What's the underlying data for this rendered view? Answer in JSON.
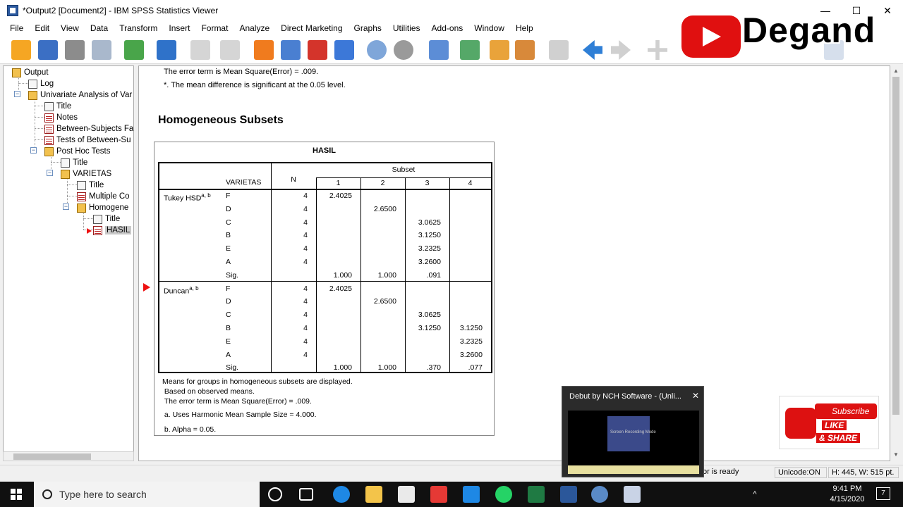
{
  "window": {
    "title": "*Output2 [Document2] - IBM SPSS Statistics Viewer",
    "minimize": "—",
    "maximize": "☐",
    "close": "✕"
  },
  "menu": [
    "File",
    "Edit",
    "View",
    "Data",
    "Transform",
    "Insert",
    "Format",
    "Analyze",
    "Direct Marketing",
    "Graphs",
    "Utilities",
    "Add-ons",
    "Window",
    "Help"
  ],
  "toolbar_icons": [
    "open-icon",
    "save-icon",
    "print-icon",
    "print-preview-icon",
    "export-icon",
    "recall-dialog-icon",
    "undo-icon",
    "redo-icon",
    "goto-data-icon",
    "goto-case-icon",
    "insert-output-icon",
    "variables-icon",
    "chart-icon",
    "select-cases-icon",
    "weight-icon",
    "split-file-icon",
    "value-labels-icon",
    "use-sets-icon",
    "script-icon",
    "show-icon",
    "back-icon",
    "forward-icon",
    "expand-icon",
    "collapse-icon"
  ],
  "outline": {
    "nodes": [
      {
        "label": "Output",
        "icon": "book-icon"
      },
      {
        "label": "Log",
        "icon": "log-icon"
      },
      {
        "label": "Univariate Analysis of Var",
        "icon": "book-icon"
      },
      {
        "label": "Title",
        "icon": "title-icon"
      },
      {
        "label": "Notes",
        "icon": "notes-icon"
      },
      {
        "label": "Between-Subjects Fa",
        "icon": "table-icon"
      },
      {
        "label": "Tests of Between-Su",
        "icon": "table-icon"
      },
      {
        "label": "Post Hoc Tests",
        "icon": "book-icon"
      },
      {
        "label": "Title",
        "icon": "title-icon"
      },
      {
        "label": "VARIETAS",
        "icon": "book-icon"
      },
      {
        "label": "Title",
        "icon": "title-icon"
      },
      {
        "label": "Multiple Co",
        "icon": "table-icon"
      },
      {
        "label": "Homogene",
        "icon": "book-icon"
      },
      {
        "label": "Title",
        "icon": "title-icon"
      },
      {
        "label": "HASIL",
        "icon": "table-icon"
      }
    ]
  },
  "viewer": {
    "top_notes": [
      "The error term is Mean Square(Error) = .009.",
      "*. The mean difference is significant at the 0.05 level."
    ],
    "heading": "Homogeneous Subsets",
    "table": {
      "title": "HASIL",
      "header_varietas": "VARIETAS",
      "header_n": "N",
      "header_subset": "Subset",
      "subset_cols": [
        "1",
        "2",
        "3",
        "4"
      ],
      "groups": [
        {
          "name": "Tukey HSD",
          "sup": "a, b",
          "rows": [
            {
              "lev": "F",
              "n": "4",
              "s": [
                "2.4025",
                "",
                "",
                ""
              ]
            },
            {
              "lev": "D",
              "n": "4",
              "s": [
                "",
                "2.6500",
                "",
                ""
              ]
            },
            {
              "lev": "C",
              "n": "4",
              "s": [
                "",
                "",
                "3.0625",
                ""
              ]
            },
            {
              "lev": "B",
              "n": "4",
              "s": [
                "",
                "",
                "3.1250",
                ""
              ]
            },
            {
              "lev": "E",
              "n": "4",
              "s": [
                "",
                "",
                "3.2325",
                ""
              ]
            },
            {
              "lev": "A",
              "n": "4",
              "s": [
                "",
                "",
                "3.2600",
                ""
              ]
            },
            {
              "lev": "Sig.",
              "n": "",
              "s": [
                "1.000",
                "1.000",
                ".091",
                ""
              ]
            }
          ]
        },
        {
          "name": "Duncan",
          "sup": "a, b",
          "rows": [
            {
              "lev": "F",
              "n": "4",
              "s": [
                "2.4025",
                "",
                "",
                ""
              ]
            },
            {
              "lev": "D",
              "n": "4",
              "s": [
                "",
                "2.6500",
                "",
                ""
              ]
            },
            {
              "lev": "C",
              "n": "4",
              "s": [
                "",
                "",
                "3.0625",
                ""
              ]
            },
            {
              "lev": "B",
              "n": "4",
              "s": [
                "",
                "",
                "3.1250",
                "3.1250"
              ]
            },
            {
              "lev": "E",
              "n": "4",
              "s": [
                "",
                "",
                "",
                "3.2325"
              ]
            },
            {
              "lev": "A",
              "n": "4",
              "s": [
                "",
                "",
                "",
                "3.2600"
              ]
            },
            {
              "lev": "Sig.",
              "n": "",
              "s": [
                "1.000",
                "1.000",
                ".370",
                ".077"
              ]
            }
          ]
        }
      ],
      "footnotes": [
        "Means for groups in homogeneous subsets are displayed.",
        " Based on observed means.",
        " The error term is Mean Square(Error) = .009.",
        " a. Uses Harmonic Mean Sample Size = 4.000.",
        " b. Alpha = 0.05."
      ]
    }
  },
  "status": {
    "processor": "or is ready",
    "unicode": "Unicode:ON",
    "dims": "H: 445, W: 515 pt."
  },
  "taskbar": {
    "search_placeholder": "Type here to search",
    "time": "9:41 PM",
    "date": "4/15/2020",
    "notifications": "7"
  },
  "overlays": {
    "channel": "Degand",
    "popup_title": "Debut by NCH Software - (Unli...",
    "popup_close": "✕",
    "popup_caption": "Screen Recording Mode",
    "subscribe": "Subscribe",
    "like": "LIKE",
    "share": "& SHARE"
  },
  "colors": {
    "accent_red": "#e01010",
    "selection": "#c9c9c9"
  }
}
